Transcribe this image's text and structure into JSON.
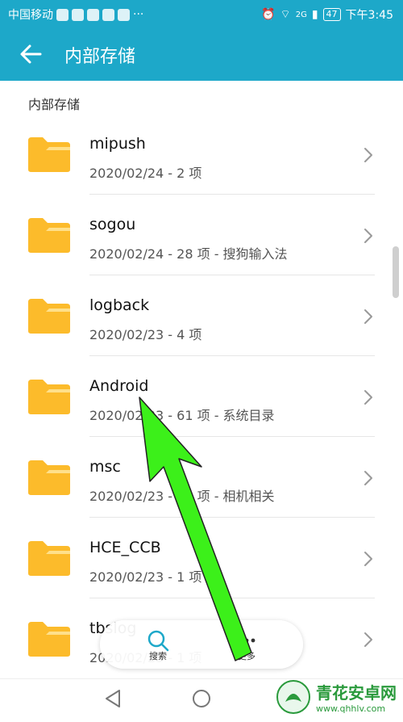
{
  "statusbar": {
    "carrier": "中国移动",
    "more": "···",
    "network": "2G",
    "battery": "47",
    "time": "下午3:45"
  },
  "appbar": {
    "title": "内部存储"
  },
  "breadcrumb": "内部存储",
  "folders": [
    {
      "name": "mipush",
      "meta": "2020/02/24 - 2 项"
    },
    {
      "name": "sogou",
      "meta": "2020/02/24 - 28 项 - 搜狗输入法"
    },
    {
      "name": "logback",
      "meta": "2020/02/23 - 4 项"
    },
    {
      "name": "Android",
      "meta": "2020/02/23 - 61 项 - 系统目录"
    },
    {
      "name": "msc",
      "meta": "2020/02/23 - 12 项 - 相机相关"
    },
    {
      "name": "HCE_CCB",
      "meta": "2020/02/23 - 1 项"
    },
    {
      "name": "tbslog",
      "meta": "2020/02/23 - 1 项"
    }
  ],
  "bottombar": {
    "search": "搜索",
    "more": "更多"
  },
  "watermark": {
    "title": "青花安卓网",
    "url": "www.qhhlv.com"
  },
  "colors": {
    "accent": "#1da8c9",
    "folder": "#fcbb2b",
    "arrow": "#3cf01a"
  }
}
